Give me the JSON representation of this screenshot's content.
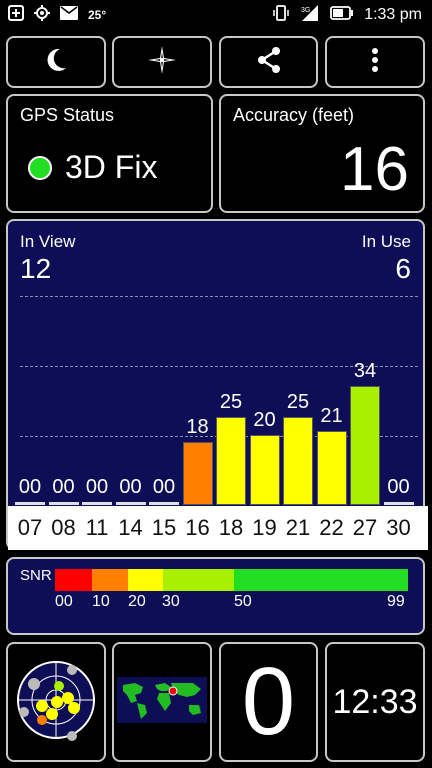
{
  "status_bar": {
    "temperature": "25°",
    "time": "1:33 pm"
  },
  "toolbar": {
    "buttons": [
      {
        "name": "night-mode-button",
        "icon": "moon-icon"
      },
      {
        "name": "compass-button",
        "icon": "compass-star-icon"
      },
      {
        "name": "share-button",
        "icon": "share-icon"
      },
      {
        "name": "menu-button",
        "icon": "more-vert-icon"
      }
    ]
  },
  "gps_status": {
    "label": "GPS Status",
    "value": "3D Fix",
    "indicator_color": "#22dd22"
  },
  "accuracy": {
    "label": "Accuracy (feet)",
    "value": "16"
  },
  "satellites": {
    "in_view_label": "In View",
    "in_view": "12",
    "in_use_label": "In Use",
    "in_use": "6"
  },
  "chart_data": {
    "type": "bar",
    "categories": [
      "07",
      "08",
      "11",
      "14",
      "15",
      "16",
      "18",
      "19",
      "21",
      "22",
      "27",
      "30"
    ],
    "values": [
      0,
      0,
      0,
      0,
      0,
      18,
      25,
      20,
      25,
      21,
      34,
      0
    ],
    "value_labels": [
      "00",
      "00",
      "00",
      "00",
      "00",
      "18",
      "25",
      "20",
      "25",
      "21",
      "34",
      "00"
    ],
    "ylim": [
      0,
      60
    ],
    "grid": true
  },
  "snr_legend": {
    "label": "SNR",
    "ticks": [
      "00",
      "10",
      "20",
      "30",
      "50",
      "99"
    ],
    "colors": [
      "#ff0000",
      "#ff8000",
      "#ffff00",
      "#a8f000",
      "#22dd22"
    ]
  },
  "bottom": {
    "sat_count": "0",
    "clock": "12:33"
  }
}
